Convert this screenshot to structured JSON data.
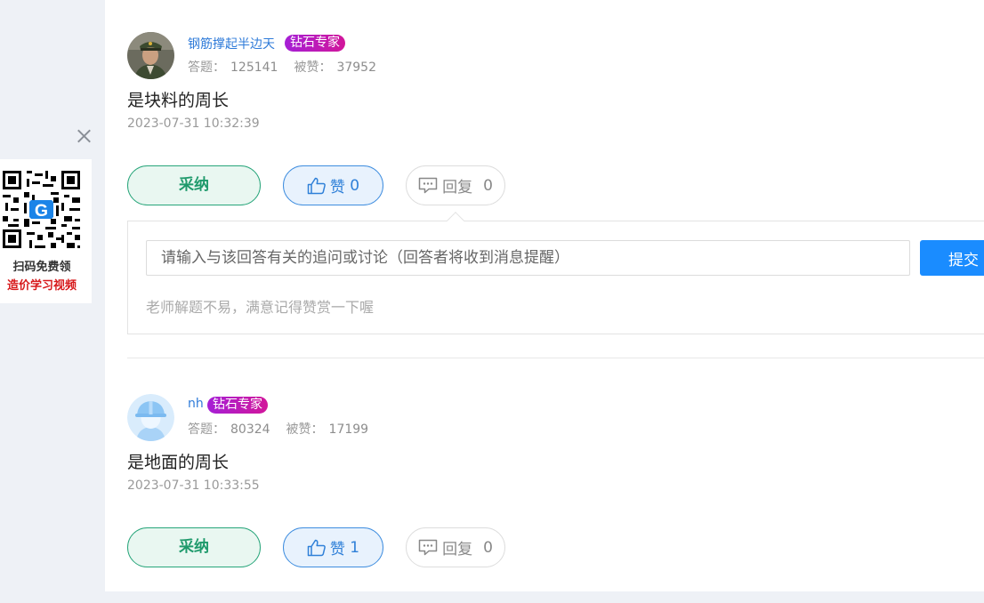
{
  "qr_widget": {
    "line1": "扫码免费领",
    "line2": "造价学习视频"
  },
  "answers": [
    {
      "user": "钢筋撑起半边天",
      "badge": "钻石专家",
      "stat_answers_label": "答题：",
      "stat_answers": "125141",
      "stat_likes_label": "被赞：",
      "stat_likes": "37952",
      "content": "是块料的周长",
      "time": "2023-07-31 10:32:39",
      "adopt_label": "采纳",
      "like_label": "赞",
      "like_count": "0",
      "reply_label": "回复",
      "reply_count": "0"
    },
    {
      "user": "nh",
      "badge": "钻石专家",
      "stat_answers_label": "答题：",
      "stat_answers": "80324",
      "stat_likes_label": "被赞：",
      "stat_likes": "17199",
      "content": "是地面的周长",
      "time": "2023-07-31 10:33:55",
      "adopt_label": "采纳",
      "like_label": "赞",
      "like_count": "1",
      "reply_label": "回复",
      "reply_count": "0"
    }
  ],
  "reply_box": {
    "placeholder": "请输入与该回答有关的追问或讨论（回答者将收到消息提醒）",
    "submit_label": "提交",
    "hint": "老师解题不易，满意记得赞赏一下喔"
  }
}
